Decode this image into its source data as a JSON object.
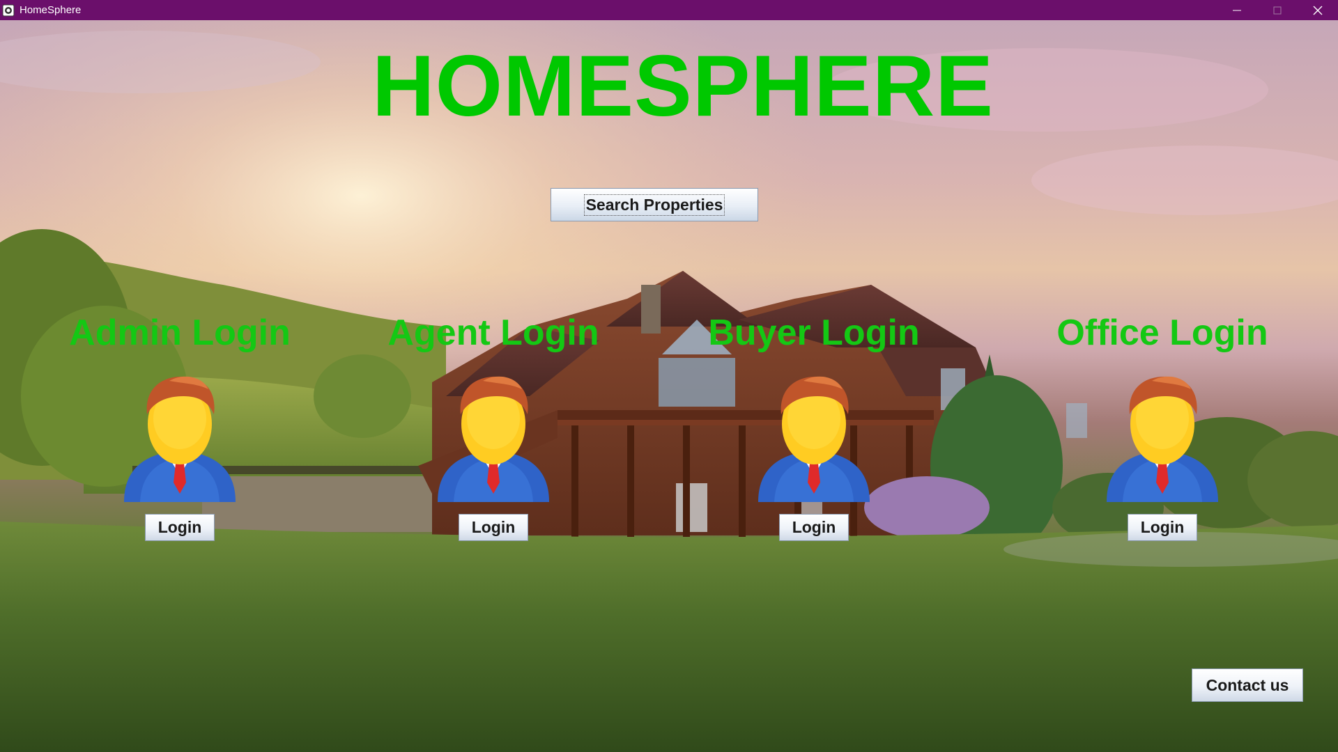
{
  "window": {
    "title": "HomeSphere",
    "controls": [
      "minimize-icon",
      "maximize-icon",
      "close-icon"
    ]
  },
  "main": {
    "heading": "HOMESPHERE",
    "search_button": "Search Properties",
    "logins": [
      {
        "title": "Admin Login",
        "button": "Login",
        "icon": "user-avatar-icon"
      },
      {
        "title": "Agent Login",
        "button": "Login",
        "icon": "user-avatar-icon"
      },
      {
        "title": "Buyer Login",
        "button": "Login",
        "icon": "user-avatar-icon"
      },
      {
        "title": "Office Login",
        "button": "Login",
        "icon": "user-avatar-icon"
      }
    ],
    "contact_button": "Contact us"
  },
  "colors": {
    "titlebar": "#6b0f6b",
    "heading": "#00c800",
    "login_title": "#14c814"
  }
}
